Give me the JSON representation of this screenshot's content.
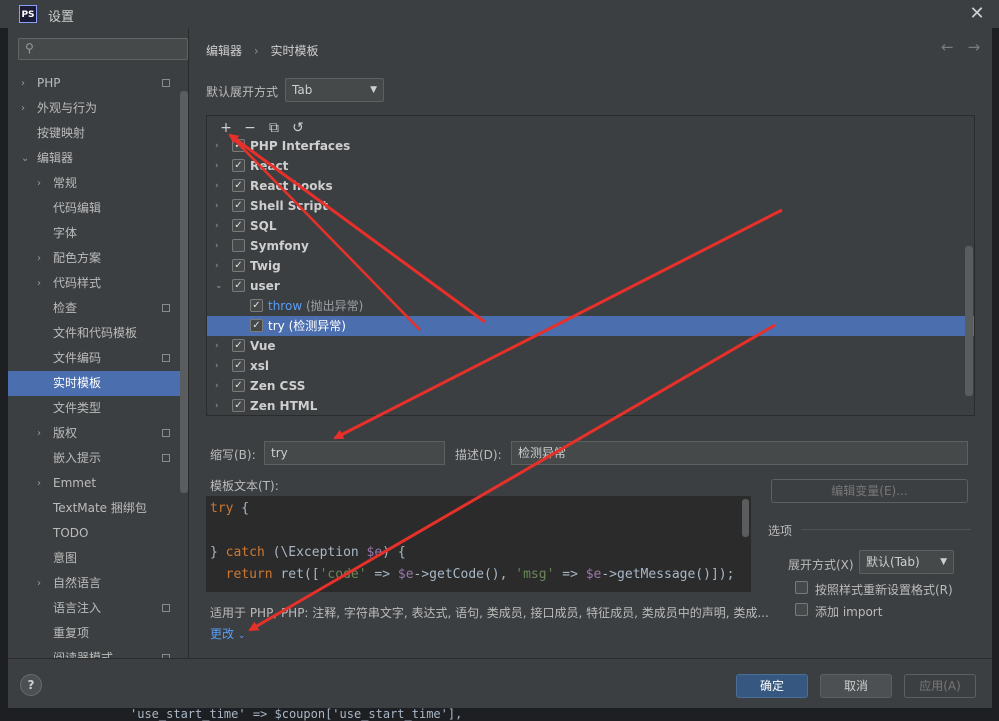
{
  "window": {
    "title": "设置",
    "logo": "PS"
  },
  "sidebar": {
    "search_placeholder": "",
    "items": [
      {
        "label": "PHP"
      },
      {
        "label": "外观与行为"
      },
      {
        "label": "按键映射"
      },
      {
        "label": "编辑器"
      },
      {
        "label": "常规"
      },
      {
        "label": "代码编辑"
      },
      {
        "label": "字体"
      },
      {
        "label": "配色方案"
      },
      {
        "label": "代码样式"
      },
      {
        "label": "检查"
      },
      {
        "label": "文件和代码模板"
      },
      {
        "label": "文件编码"
      },
      {
        "label": "实时模板"
      },
      {
        "label": "文件类型"
      },
      {
        "label": "版权"
      },
      {
        "label": "嵌入提示"
      },
      {
        "label": "Emmet"
      },
      {
        "label": "TextMate 捆绑包"
      },
      {
        "label": "TODO"
      },
      {
        "label": "意图"
      },
      {
        "label": "自然语言"
      },
      {
        "label": "语言注入"
      },
      {
        "label": "重复项"
      },
      {
        "label": "阅读器模式"
      }
    ]
  },
  "main": {
    "breadcrumb": [
      "编辑器",
      "›",
      "实时模板"
    ],
    "expand_label": "默认展开方式",
    "expand_value": "Tab",
    "toolbar": [
      "+",
      "−",
      "⧉",
      "↺"
    ],
    "groups": [
      {
        "name": "PHP Interfaces"
      },
      {
        "name": "React"
      },
      {
        "name": "React hooks"
      },
      {
        "name": "Shell Script"
      },
      {
        "name": "SQL"
      },
      {
        "name": "Symfony"
      },
      {
        "name": "Twig"
      },
      {
        "name": "user"
      }
    ],
    "user_children": [
      {
        "abbr": "throw",
        "desc": "(抛出异常)"
      },
      {
        "abbr": "try",
        "desc": "(检测异常)"
      }
    ],
    "groups_after": [
      {
        "name": "Vue"
      },
      {
        "name": "xsl"
      },
      {
        "name": "Zen CSS"
      },
      {
        "name": "Zen HTML"
      }
    ],
    "abbr_label": "缩写(B):",
    "abbr_value": "try",
    "desc_label": "描述(D):",
    "desc_value": "检测异常",
    "template_text_label": "模板文本(T):",
    "code_lines": [
      "try {",
      "",
      "} catch (\\Exception $e) {",
      "  return ret(['code' => $e->getCode(), 'msg' => $e->getMessage()]);"
    ],
    "edit_vars_button": "编辑变量(E)...",
    "options_title": "选项",
    "expand_with_label": "展开方式(X)",
    "expand_with_value": "默认(Tab)",
    "reformat_label": "按照样式重新设置格式(R)",
    "add_import_label": "添加 import",
    "applicable_text": "适用于 PHP, PHP: 注释, 字符串文字, 表达式, 语句, 类成员, 接口成员, 特征成员, 类成员中的声明, 类成...",
    "change_link": "更改"
  },
  "footer": {
    "ok": "确定",
    "cancel": "取消",
    "apply": "应用(A)",
    "help": "?"
  },
  "background_code": "'use_start_time' => $coupon['use_start_time'],",
  "colors": {
    "selection": "#4b6eaf",
    "ok_button": "#365880",
    "arrow": "#e8302a"
  }
}
